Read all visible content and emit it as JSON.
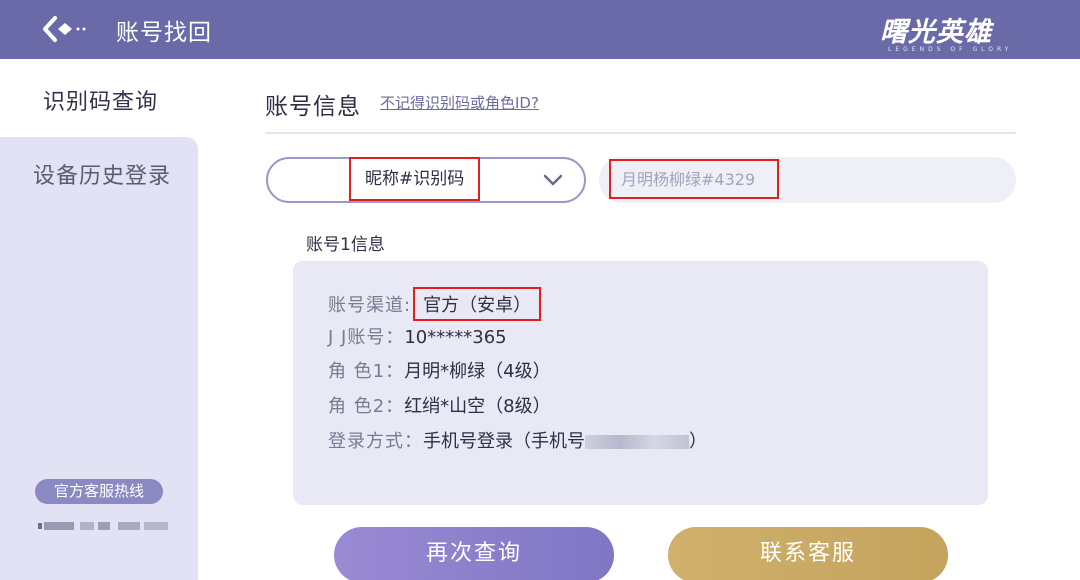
{
  "header": {
    "title": "账号找回",
    "back_icon": "back-arrow-icon",
    "logo_text": "曙光英雄",
    "logo_subtext": "LEGENDS OF GLORY",
    "bg_color": "#6a6aa8"
  },
  "sidebar": {
    "items": [
      {
        "label": "识别码查询",
        "active": true
      },
      {
        "label": "设备历史登录",
        "active": false
      }
    ],
    "hotline_label": "官方客服热线"
  },
  "main": {
    "section_title": "账号信息",
    "forgot_link": "不记得识别码或角色ID?",
    "search_type": {
      "selected": "昵称#识别码",
      "icon": "chevron-down-icon"
    },
    "search_input": {
      "value": "月明杨柳绿#4329"
    },
    "account_header": "账号1信息",
    "account": {
      "channel_label": "账号渠道:",
      "channel_value": "官方（安卓）",
      "jj_label": "J J账号：",
      "jj_value": "10*****365",
      "role1_label": "角 色1：",
      "role1_value": "月明*柳绿（4级）",
      "role2_label": "角 色2：",
      "role2_value": "红绡*山空（8级）",
      "login_label": "登录方式：",
      "login_value": "手机号登录（手机号",
      "login_suffix": "）"
    },
    "buttons": {
      "retry": "再次查询",
      "contact": "联系客服"
    }
  },
  "colors": {
    "accent": "#6a6aa8",
    "highlight": "#e02020",
    "gold": "#c9a963"
  }
}
